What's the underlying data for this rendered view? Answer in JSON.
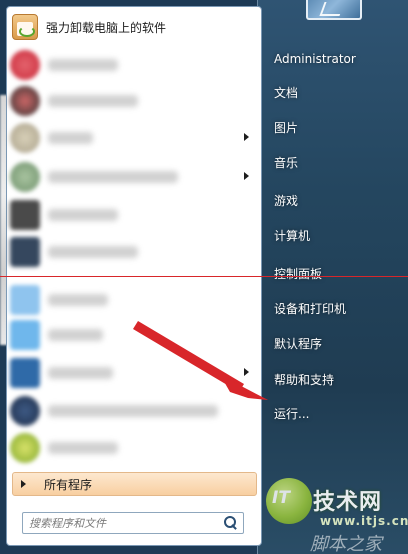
{
  "start_menu": {
    "top_program": {
      "label": "强力卸载电脑上的软件",
      "icon": "uninstall-app-icon"
    },
    "all_programs_label": "所有程序",
    "search": {
      "placeholder": "搜索程序和文件",
      "value": ""
    },
    "right_items": [
      "Administrator",
      "文档",
      "图片",
      "音乐",
      "游戏",
      "计算机",
      "控制面板",
      "设备和打印机",
      "默认程序",
      "帮助和支持",
      "运行..."
    ]
  },
  "watermark": {
    "logo_text": "IT",
    "title": "技术网",
    "url": "www.itjs.cn",
    "site": "脚本之家"
  },
  "colors": {
    "annotation_red": "#d8262a",
    "right_panel": "#24465f",
    "all_programs_bg": "#f8cfa1"
  }
}
